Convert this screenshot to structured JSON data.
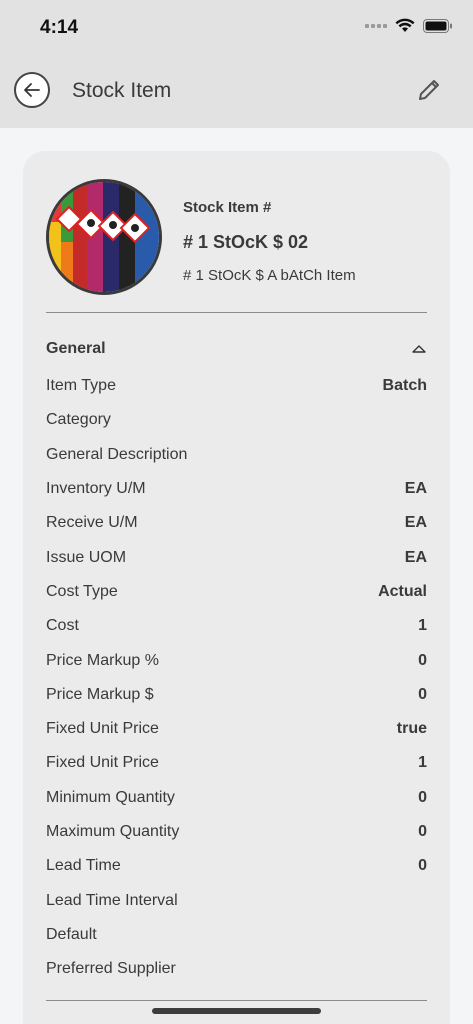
{
  "status": {
    "time": "4:14"
  },
  "header": {
    "title": "Stock Item"
  },
  "item": {
    "label": "Stock Item #",
    "number": "# 1 StOcK $ 02",
    "description": "# 1 StOcK $ A bAtCh Item"
  },
  "general": {
    "title": "General",
    "rows": [
      {
        "label": "Item Type",
        "value": "Batch"
      },
      {
        "label": "Category",
        "value": ""
      },
      {
        "label": "General Description",
        "value": ""
      },
      {
        "label": "Inventory U/M",
        "value": "EA"
      },
      {
        "label": "Receive U/M",
        "value": "EA"
      },
      {
        "label": "Issue UOM",
        "value": "EA"
      },
      {
        "label": "Cost Type",
        "value": "Actual"
      },
      {
        "label": "Cost",
        "value": "1"
      },
      {
        "label": "Price Markup %",
        "value": "0"
      },
      {
        "label": "Price Markup $",
        "value": "0"
      },
      {
        "label": "Fixed Unit Price",
        "value": "true"
      },
      {
        "label": "Fixed Unit Price",
        "value": "1"
      },
      {
        "label": "Minimum Quantity",
        "value": "0"
      },
      {
        "label": "Maximum Quantity",
        "value": "0"
      },
      {
        "label": "Lead Time",
        "value": "0"
      },
      {
        "label": "Lead Time Interval",
        "value": ""
      },
      {
        "label": "Default",
        "value": ""
      },
      {
        "label": "Preferred Supplier",
        "value": ""
      }
    ]
  },
  "icons": {
    "back": "back-arrow-icon",
    "edit": "pencil-icon",
    "collapse": "chevron-up-icon"
  }
}
